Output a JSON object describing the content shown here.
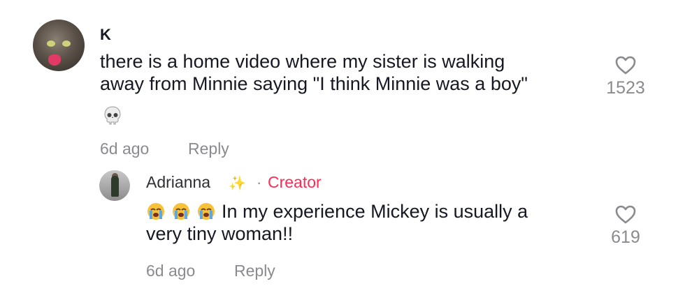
{
  "comment": {
    "username": "K",
    "text_line1": "there is a home video where my sister is walking",
    "text_line2": "away from Minnie saying \"I think Minnie was a boy\"",
    "emoji": "skull",
    "time": "6d ago",
    "reply_label": "Reply",
    "like_count": "1523"
  },
  "reply": {
    "username": "Adrianna",
    "badge_icon": "sparkles",
    "separator": "·",
    "creator_label": "Creator",
    "emojis": [
      "loudly-crying-face",
      "loudly-crying-face",
      "loudly-crying-face"
    ],
    "text_line1": "In my experience Mickey is usually a",
    "text_line2": "very tiny woman!!",
    "time": "6d ago",
    "reply_label": "Reply",
    "like_count": "619"
  },
  "colors": {
    "creator": "#fe2c55",
    "muted": "#8a8b91",
    "text": "#161823"
  }
}
